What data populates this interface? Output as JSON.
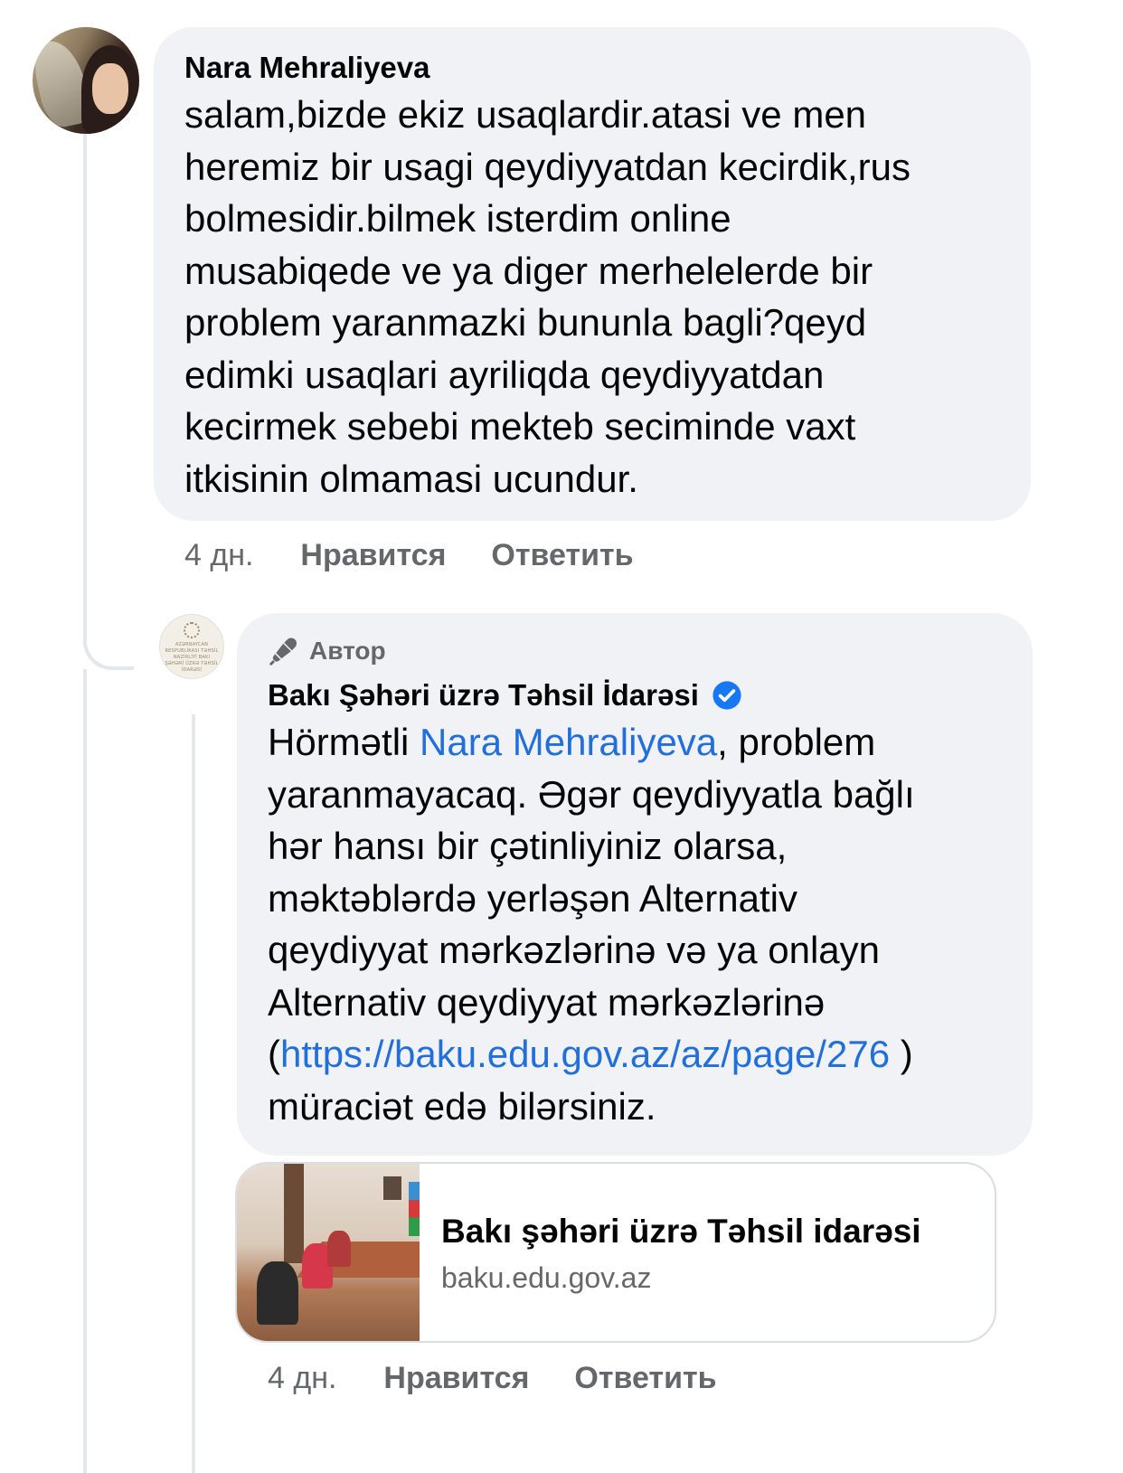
{
  "comment": {
    "author": "Nara Mehraliyeva",
    "text": "salam,bizde ekiz usaqlardir.atasi ve men\nheremiz bir usagi qeydiyyatdan kecirdik,rus\nbolmesidir.bilmek isterdim online\nmusabiqede ve ya diger merhelelerde bir\nproblem yaranmazki bununla bagli?qeyd\nedimki usaqlari ayriliqda qeydiyyatdan\nkecirmek sebebi mekteb seciminde vaxt\nitkisinin olmamasi ucundur.",
    "time": "4 дн.",
    "like_label": "Нравится",
    "reply_label": "Ответить"
  },
  "reply": {
    "badge_label": "Автор",
    "author": "Bakı Şəhəri üzrə Təhsil İdarəsi",
    "avatar_text": "AZƏRBAYCAN RESPUBLİKASI TƏHSİL NAZİRLİYİ BAKI ŞƏHƏRİ ÜZRƏ TƏHSİL İDARƏSİ",
    "text_prefix": "Hörmətli ",
    "mention": "Nara Mehraliyeva",
    "text_middle": ", problem\nyaranmayacaq. Əgər qeydiyyatla bağlı\nhər hansı bir çətinliyiniz olarsa,\nməktəblərdə yerləşən Alternativ\nqeydiyyat mərkəzlərinə və ya onlayn\nAlternativ qeydiyyat mərkəzlərinə\n(",
    "link": "https://baku.edu.gov.az/az/page/276",
    "text_suffix": " )\nmüraciət edə bilərsiniz.",
    "time": "4 дн.",
    "like_label": "Нравится",
    "reply_label": "Ответить",
    "preview": {
      "title": "Bakı şəhəri üzrə Təhsil idarəsi",
      "domain": "baku.edu.gov.az"
    }
  },
  "colors": {
    "bubble_bg": "#f0f2f5",
    "link": "#216fdb",
    "secondary_text": "#65676b",
    "verified": "#1877f2"
  },
  "icons": {
    "badge": "microphone-icon",
    "verified": "verified-check-icon"
  }
}
